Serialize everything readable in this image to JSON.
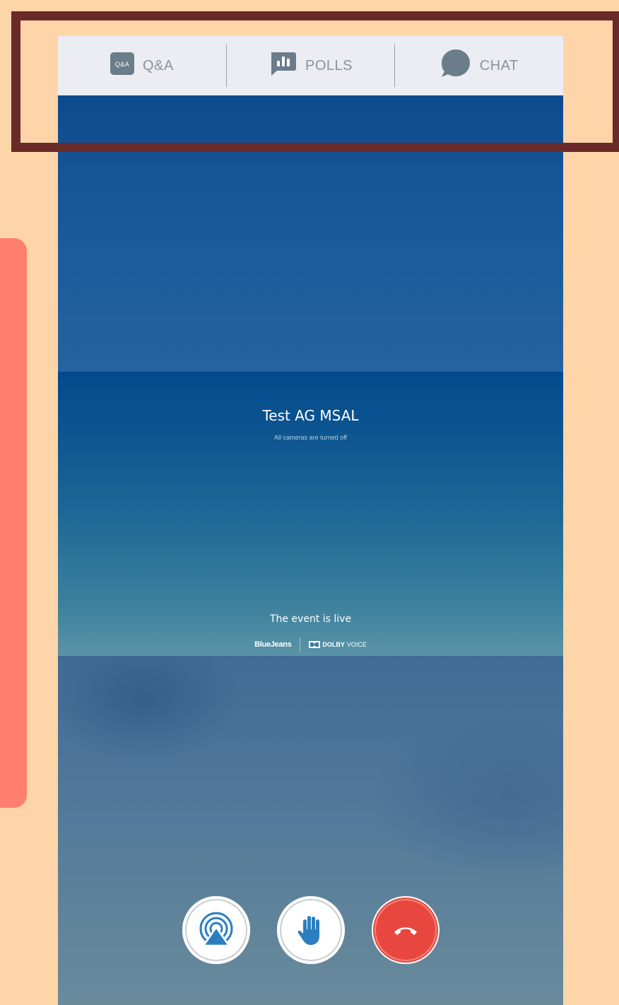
{
  "tabs": [
    {
      "label": "Q&A",
      "icon": "qa-icon",
      "icon_text": "Q&A"
    },
    {
      "label": "POLLS",
      "icon": "polls-icon"
    },
    {
      "label": "CHAT",
      "icon": "chat-icon"
    }
  ],
  "event": {
    "title": "Test AG MSAL",
    "subtitle": "All cameras are turned off",
    "status": "The event is live",
    "brand_primary": "BlueJeans",
    "brand_secondary_bold": "DOLBY",
    "brand_secondary_light": "VOICE"
  },
  "controls": [
    {
      "name": "share-screen",
      "icon": "airplay-icon"
    },
    {
      "name": "raise-hand",
      "icon": "hand-icon"
    },
    {
      "name": "end-call",
      "icon": "phone-hangup-icon"
    }
  ],
  "colors": {
    "page_bg": "#fed5a8",
    "highlight": "#6b2a2a",
    "side_panel": "#ff7f6f",
    "tab_bg": "#ebedf2",
    "tab_icon": "#6b7c8a",
    "accent_blue": "#2b7fc1",
    "end_call": "#e8473f"
  }
}
